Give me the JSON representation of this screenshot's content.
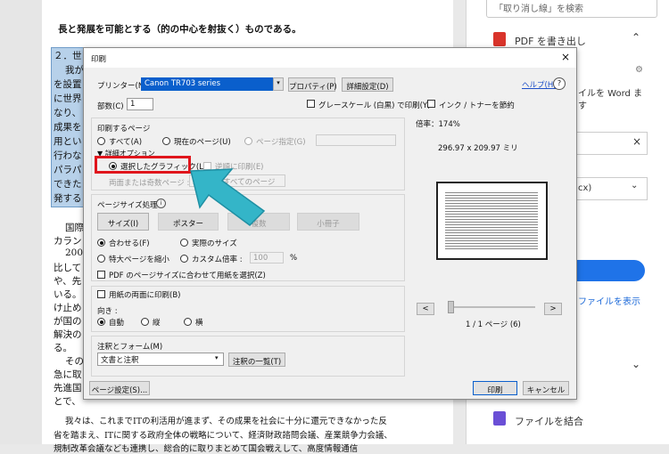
{
  "document": {
    "lines": [
      "長と発展を可能とする（的の中心を射抜く）ものである。",
      "２．世",
      "我が",
      "を設置",
      "に世界",
      "なり、",
      "成果を",
      "用とい",
      "行わな",
      "パラパ",
      "できた",
      "発する",
      "国際",
      "カラン",
      "2001",
      "比して",
      "や、先",
      "いる。",
      "け止め",
      "が国の",
      "解決の",
      "る。",
      "その",
      "急に取",
      "先進国",
      "とで、",
      "我々は、これまでITの利活用が進まず、その成果を社会に十分に還元できなかった反",
      "省を踏まえ、ITに関する政府全体の戦略について、経済財政諮問会議、産業競争力会議、",
      "規制改革会議なども連携し、総合的に取りまとめて国会戦えして、高度情報通信"
    ]
  },
  "right_panel": {
    "search_placeholder": "「取り消し線」を検索",
    "pdf_export": "PDF を書き出し",
    "convert_text_1": "イルを Word ま",
    "convert_text_2": "す",
    "format_suffix": "cx)",
    "show_file_link": "ファイルを表示",
    "combine_files": "ファイルを結合"
  },
  "dialog": {
    "title": "印刷",
    "printer_label": "プリンター(N) :",
    "printer_value": "Canon TR703 series",
    "properties_btn": "プロパティ(P)",
    "advanced_btn": "詳細設定(D)",
    "help_link": "ヘルプ(H)",
    "copies_label": "部数(C) :",
    "copies_value": "1",
    "grayscale_label": "グレースケール (白黒) で印刷(Y)",
    "ink_save_label": "インク / トナーを節約",
    "pages_section": "印刷するページ",
    "all_label": "すべて(A)",
    "current_page_label": "現在のページ(U)",
    "page_range_label": "ページ指定(G)",
    "more_options": "▼ 詳細オプション",
    "selected_graphic_label": "選択したグラフィック(L)",
    "reverse_label": "逆順に印刷(E)",
    "odd_even_label": "両面または奇数ページ :",
    "odd_even_value": "範囲内のすべてのページ",
    "sizing_section": "ページサイズ処理",
    "size_btn": "サイズ(I)",
    "poster_btn": "ポスター",
    "multiple_btn": "複数",
    "booklet_btn": "小冊子",
    "fit_label": "合わせる(F)",
    "actual_size_label": "実際のサイズ",
    "shrink_label": "特大ページを縮小",
    "custom_scale_label": "カスタム倍率 :",
    "custom_scale_value": "100",
    "percent": "%",
    "pdf_pagesize_label": "PDF のページサイズに合わせて用紙を選択(Z)",
    "duplex_label": "用紙の両面に印刷(B)",
    "orientation_label": "向き :",
    "auto_label": "自動",
    "portrait_label": "縦",
    "landscape_label": "横",
    "annotations_section": "注釈とフォーム(M)",
    "annotations_value": "文書と注釈",
    "annotations_summary_btn": "注釈の一覧(T)",
    "page_setup_btn": "ページ設定(S)...",
    "scale_readout": "倍率：174%",
    "paper_size": "296.97 x 209.97 ミリ",
    "prev_btn": "<",
    "next_btn": ">",
    "page_counter": "1 / 1 ページ (6)",
    "print_btn": "印刷",
    "cancel_btn": "キャンセル",
    "close_glyph": "×",
    "help_glyph": "?"
  },
  "colors": {
    "highlight_box": "#e0151c",
    "arrow": "#34b5c8",
    "printer_select": "#0a5fcc",
    "selection_bg": "#b7d1ea"
  }
}
